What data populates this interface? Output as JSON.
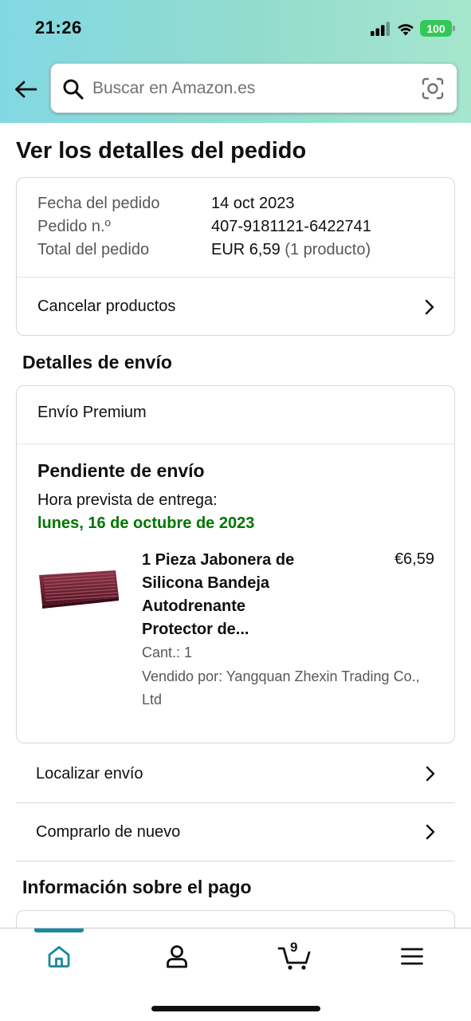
{
  "status_bar": {
    "time": "21:26",
    "battery": "100",
    "icons": [
      "signal-icon",
      "wifi-icon",
      "battery-icon"
    ]
  },
  "header": {
    "back_icon": "back-arrow-icon",
    "search": {
      "placeholder": "Buscar en Amazon.es",
      "value": "",
      "icons": [
        "search-icon",
        "camera-scan-icon"
      ]
    }
  },
  "page_title": "Ver los detalles del pedido",
  "order_summary": {
    "rows": [
      {
        "label": "Fecha del pedido",
        "value": "14 oct 2023"
      },
      {
        "label": "Pedido n.º",
        "value": "407-9181121-6422741"
      },
      {
        "label": "Total del pedido",
        "value": "EUR 6,59",
        "extra": "(1 producto)"
      }
    ],
    "cancel_label": "Cancelar productos"
  },
  "shipping": {
    "section_title": "Detalles de envío",
    "type": "Envío Premium",
    "status": "Pendiente de envío",
    "eta_label": "Hora prevista de entrega:",
    "eta_date": "lunes, 16 de octubre de 2023",
    "item": {
      "title_lines": [
        "1 Pieza Jabonera de",
        "Silicona Bandeja",
        "Autodrenante",
        "Protector de..."
      ],
      "price": "€6,59",
      "qty": "Cant.: 1",
      "seller_lines": [
        "Vendido por: Yangquan Zhexin Trading Co.,",
        "Ltd"
      ],
      "thumb_color": "#6b1f32"
    }
  },
  "links": {
    "track": "Localizar envío",
    "buy_again": "Comprarlo de nuevo"
  },
  "payment": {
    "section_title": "Información sobre el pago"
  },
  "tabbar": {
    "active_color": "#1a8a9c",
    "tabs": [
      {
        "name": "home",
        "icon": "home-icon",
        "active": true
      },
      {
        "name": "account",
        "icon": "person-icon",
        "active": false
      },
      {
        "name": "cart",
        "icon": "cart-icon",
        "count": "9",
        "active": false
      },
      {
        "name": "menu",
        "icon": "menu-icon",
        "active": false
      }
    ]
  },
  "colors": {
    "accent": "#1a8a9c",
    "delivery_green": "#007600",
    "text": "#0f1111",
    "muted": "#565959"
  }
}
